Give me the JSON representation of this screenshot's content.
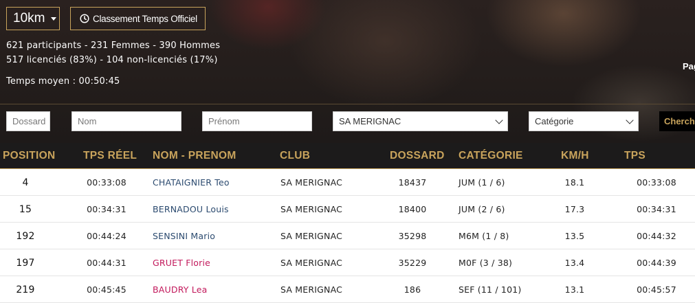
{
  "header": {
    "distance_label": "10km",
    "classement_label": "Classement Temps Officiel",
    "stats_line1": "621 participants - 231 Femmes - 390 Hommes",
    "stats_line2": "517 licenciés (83%) - 104 non-licenciés (17%)",
    "stats_line3": "Temps moyen : 00:50:45",
    "pagination_fragment": "Pag"
  },
  "filters": {
    "dossard_placeholder": "Dossard",
    "nom_placeholder": "Nom",
    "prenom_placeholder": "Prénom",
    "club_selected": "SA MERIGNAC",
    "categorie_selected": "Catégorie",
    "search_label": "Cherche"
  },
  "table": {
    "headers": {
      "position": "POSITION",
      "tps_reel": "TPS RÉEL",
      "nom_prenom": "NOM - PRENOM",
      "club": "CLUB",
      "dossard": "DOSSARD",
      "categorie": "CATÉGORIE",
      "kmh": "KM/H",
      "tps_officiel": "TPS OFFICIEL"
    },
    "rows": [
      {
        "position": "4",
        "tps_reel": "00:33:08",
        "name": "CHATAIGNIER Teo",
        "gender": "M",
        "club": "SA MERIGNAC",
        "dossard": "18437",
        "categorie": "JUM (1 / 6)",
        "kmh": "18.1",
        "tps_officiel": "00:33:08"
      },
      {
        "position": "15",
        "tps_reel": "00:34:31",
        "name": "BERNADOU Louis",
        "gender": "M",
        "club": "SA MERIGNAC",
        "dossard": "18400",
        "categorie": "JUM (2 / 6)",
        "kmh": "17.3",
        "tps_officiel": "00:34:31"
      },
      {
        "position": "192",
        "tps_reel": "00:44:24",
        "name": "SENSINI Mario",
        "gender": "M",
        "club": "SA MERIGNAC",
        "dossard": "35298",
        "categorie": "M6M (1 / 8)",
        "kmh": "13.5",
        "tps_officiel": "00:44:32"
      },
      {
        "position": "197",
        "tps_reel": "00:44:31",
        "name": "GRUET Florie",
        "gender": "F",
        "club": "SA MERIGNAC",
        "dossard": "35229",
        "categorie": "M0F (3 / 38)",
        "kmh": "13.4",
        "tps_officiel": "00:44:39"
      },
      {
        "position": "219",
        "tps_reel": "00:45:45",
        "name": "BAUDRY Lea",
        "gender": "F",
        "club": "SA MERIGNAC",
        "dossard": "186",
        "categorie": "SEF (11 / 101)",
        "kmh": "13.1",
        "tps_officiel": "00:45:57"
      }
    ]
  },
  "colors": {
    "accent_gold": "#c9a45c",
    "header_bg": "#1c1b1b",
    "male_name": "#2b4a6f",
    "female_name": "#c2185b"
  },
  "icons": {
    "distance_dropdown": "caret-down-icon",
    "classement": "clock-icon",
    "select": "chevron-down-icon"
  }
}
